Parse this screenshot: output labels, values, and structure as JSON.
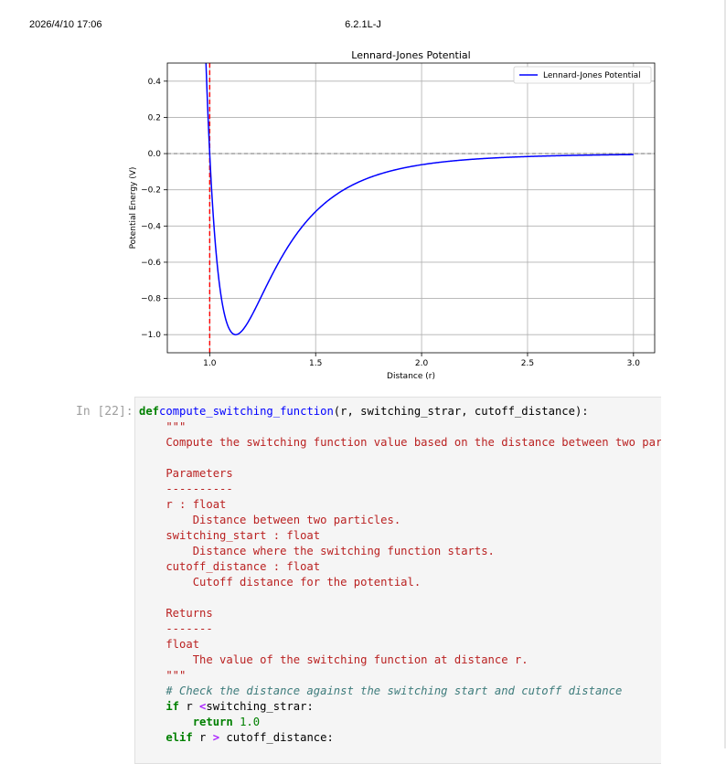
{
  "page": {
    "timestamp": "2026/4/10 17:06",
    "doc_title": "6.2.1L-J"
  },
  "chart_data": {
    "type": "line",
    "title": "Lennard-Jones Potential",
    "xlabel": "Distance (r)",
    "ylabel": "Potential Energy (V)",
    "xlim": [
      0.8,
      3.1
    ],
    "ylim": [
      -1.1,
      0.5
    ],
    "xticks": [
      1.0,
      1.5,
      2.0,
      2.5,
      3.0
    ],
    "xtick_labels": [
      "1.0",
      "1.5",
      "2.0",
      "2.5",
      "3.0"
    ],
    "yticks": [
      -1.0,
      -0.8,
      -0.6,
      -0.4,
      -0.2,
      0.0,
      0.2,
      0.4
    ],
    "ytick_labels": [
      "−1.0",
      "−0.8",
      "−0.6",
      "−0.4",
      "−0.2",
      "0.0",
      "0.2",
      "0.4"
    ],
    "grid": true,
    "legend_position": "top-right",
    "series": [
      {
        "name": "Lennard-Jones Potential",
        "color": "#0000ff",
        "function": "4*(r^-12 - r^-6)",
        "x_range": [
          0.97,
          3.0
        ]
      }
    ],
    "hlines": [
      {
        "y": 0.0,
        "color": "#808080",
        "style": "dashed"
      }
    ],
    "vlines": [
      {
        "x": 1.0,
        "color": "#ff0000",
        "style": "dashed"
      }
    ]
  },
  "cell": {
    "prompt": "In [22]:",
    "code_lines": [
      [
        [
          "kw",
          "def"
        ],
        [
          "",
          "compute_switching_function"
        ],
        [
          "",
          "("
        ],
        [
          "",
          "r, switching_strar, cutoff_distance"
        ],
        [
          "",
          "):"
        ]
      ],
      [
        [
          "str",
          "    \"\"\""
        ]
      ],
      [
        [
          "str",
          "    Compute the switching function value based on the distance between two particles."
        ]
      ],
      [
        [
          "",
          ""
        ]
      ],
      [
        [
          "str",
          "    Parameters"
        ]
      ],
      [
        [
          "str",
          "    ----------"
        ]
      ],
      [
        [
          "str",
          "    r : float"
        ]
      ],
      [
        [
          "str",
          "        Distance between two particles."
        ]
      ],
      [
        [
          "str",
          "    switching_start : float"
        ]
      ],
      [
        [
          "str",
          "        Distance where the switching function starts."
        ]
      ],
      [
        [
          "str",
          "    cutoff_distance : float"
        ]
      ],
      [
        [
          "str",
          "        Cutoff distance for the potential."
        ]
      ],
      [
        [
          "",
          ""
        ]
      ],
      [
        [
          "str",
          "    Returns"
        ]
      ],
      [
        [
          "str",
          "    -------"
        ]
      ],
      [
        [
          "str",
          "    float"
        ]
      ],
      [
        [
          "str",
          "        The value of the switching function at distance r."
        ]
      ],
      [
        [
          "str",
          "    \"\"\""
        ]
      ],
      [
        [
          "cm",
          "    # Check the distance against the switching start and cutoff distance"
        ]
      ],
      [
        [
          "kw",
          "    if"
        ],
        [
          "",
          " r "
        ],
        [
          "op",
          "<"
        ],
        [
          "",
          "switching_strar:"
        ]
      ],
      [
        [
          "kw",
          "        return"
        ],
        [
          "",
          " "
        ],
        [
          "num",
          "1.0"
        ]
      ],
      [
        [
          "kw",
          "    elif"
        ],
        [
          "",
          " r "
        ],
        [
          "op",
          ">"
        ],
        [
          "",
          " cutoff_distance:"
        ]
      ]
    ]
  }
}
